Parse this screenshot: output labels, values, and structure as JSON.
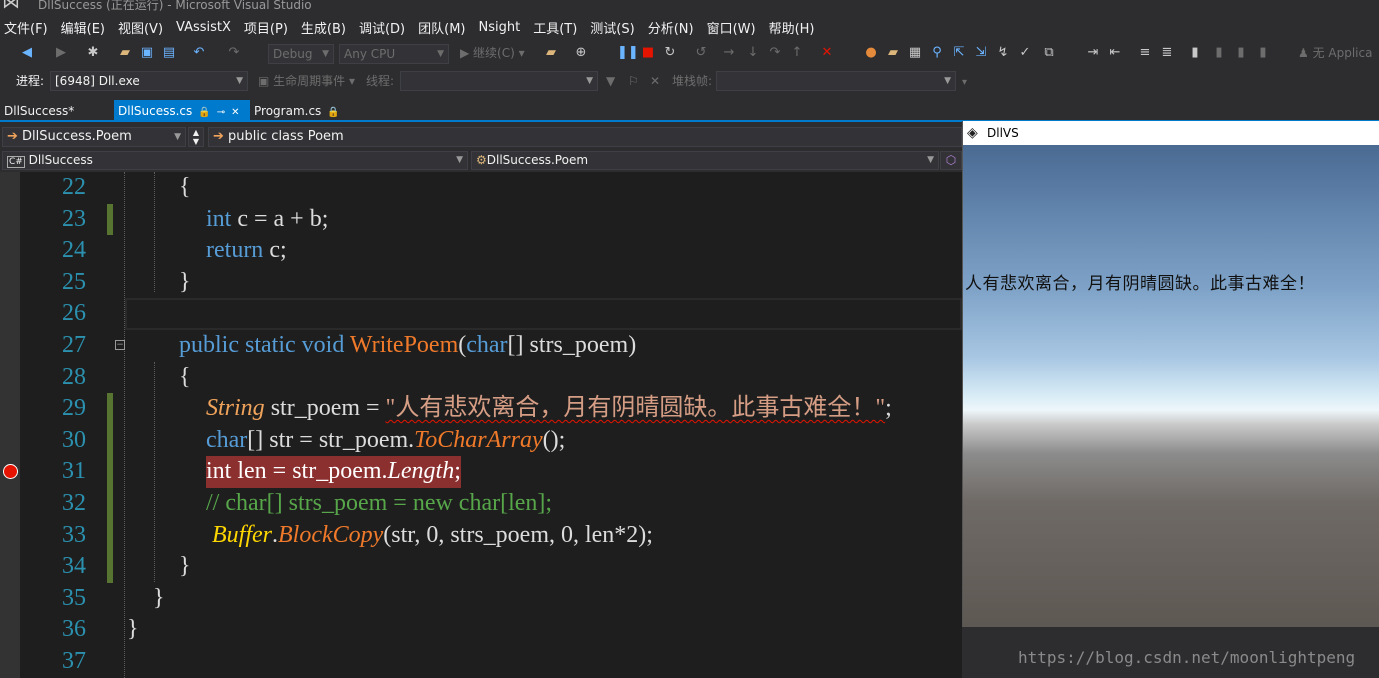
{
  "window": {
    "title": "DllSuccess (正在运行) - Microsoft Visual Studio"
  },
  "menu": [
    "文件(F)",
    "编辑(E)",
    "视图(V)",
    "VAssistX",
    "项目(P)",
    "生成(B)",
    "调试(D)",
    "团队(M)",
    "Nsight",
    "工具(T)",
    "测试(S)",
    "分析(N)",
    "窗口(W)",
    "帮助(H)"
  ],
  "toolbar": {
    "config": "Debug",
    "platform": "Any CPU",
    "continue_label": "继续(C)",
    "app_insights": "无 Applica"
  },
  "debugbar": {
    "process_label": "进程:",
    "process_value": "[6948] Dll.exe",
    "lifecycle_label": "生命周期事件",
    "thread_label": "线程:",
    "stackframe_label": "堆栈帧:"
  },
  "tabs": [
    {
      "label": "DllSuccess*",
      "active": false
    },
    {
      "label": "DllSucess.cs",
      "active": true
    },
    {
      "label": "Program.cs",
      "active": false
    }
  ],
  "navbar": {
    "namespace": "DllSuccess.Poem",
    "member": "public class Poem",
    "project": "DllSuccess",
    "type": "DllSuccess.Poem"
  },
  "editor": {
    "line_numbers": [
      "22",
      "23",
      "24",
      "25",
      "26",
      "27",
      "28",
      "29",
      "30",
      "31",
      "32",
      "33",
      "34",
      "35",
      "36",
      "37"
    ],
    "l22": "{",
    "l23": "int c = a + b;",
    "l24_kw": "return",
    "l24_rest": " c;",
    "l25": "}",
    "l27": {
      "public": "public",
      "static": "static",
      "void": "void",
      "name": "WritePoem",
      "open": "(",
      "char": "char",
      "rest": "[] strs_poem)"
    },
    "l28": "{",
    "l29": {
      "type": "String",
      "mid": " str_poem = ",
      "str": "\"人有悲欢离合，月有阴晴圆缺。此事古难全！\"",
      "end": ";"
    },
    "l30": {
      "char": "char",
      "mid": "[] str = str_poem.",
      "method": "ToCharArray",
      "end": "();"
    },
    "l31": {
      "int": "int",
      "mid": " len = str_poem.",
      "prop": "Length",
      "end": ";"
    },
    "l32": "// char[] strs_poem = new char[len];",
    "l33": {
      "buf": "Buffer",
      "dot": ".",
      "method": "BlockCopy",
      "end": "(str, 0, strs_poem, 0, len*2);"
    },
    "l34": "}",
    "l35": "}",
    "l36": "}"
  },
  "game_window": {
    "title": "DllVS",
    "text": "人有悲欢离合，月有阴晴圆缺。此事古难全！"
  },
  "watermark": "https://blog.csdn.net/moonlightpeng"
}
